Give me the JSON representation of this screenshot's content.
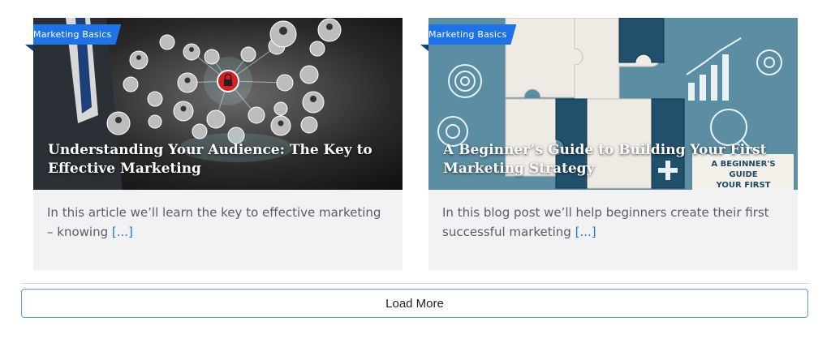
{
  "posts": [
    {
      "category": "Marketing Basics",
      "title": "Understanding Your Audience: The Key to Effective Marketing",
      "excerpt": "In this article we’ll learn the key to effective marketing – knowing",
      "more_link": "[...]"
    },
    {
      "category": "Marketing Basics",
      "title": "A Beginner’s Guide to Building Your First Marketing Strategy",
      "excerpt": "In this blog post we’ll help beginners create their first successful marketing",
      "more_link": "[...]"
    }
  ],
  "load_more_label": "Load More",
  "thumb2_sign_text": "A BEGINNER'S GUIDE YOUR FIRST",
  "colors": {
    "accent": "#1e73e8",
    "card_bg": "#f2f2f4",
    "text": "#5c5c66"
  }
}
